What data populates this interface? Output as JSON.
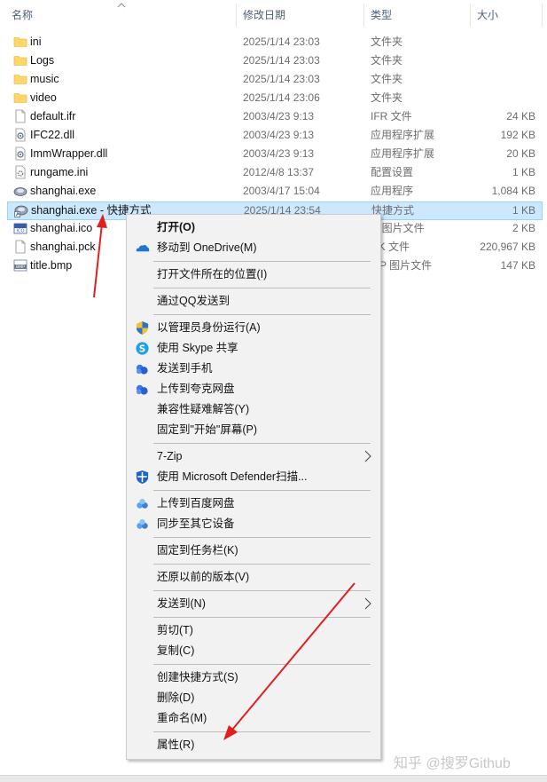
{
  "columns": {
    "name": "名称",
    "date": "修改日期",
    "type": "类型",
    "size": "大小"
  },
  "files": [
    {
      "name": "ini",
      "date": "2025/1/14 23:03",
      "type": "文件夹",
      "size": "",
      "icon": "folder-icon"
    },
    {
      "name": "Logs",
      "date": "2025/1/14 23:03",
      "type": "文件夹",
      "size": "",
      "icon": "folder-icon"
    },
    {
      "name": "music",
      "date": "2025/1/14 23:03",
      "type": "文件夹",
      "size": "",
      "icon": "folder-icon"
    },
    {
      "name": "video",
      "date": "2025/1/14 23:06",
      "type": "文件夹",
      "size": "",
      "icon": "folder-icon"
    },
    {
      "name": "default.ifr",
      "date": "2003/4/23 9:13",
      "type": "IFR 文件",
      "size": "24 KB",
      "icon": "file-icon"
    },
    {
      "name": "IFC22.dll",
      "date": "2003/4/23 9:13",
      "type": "应用程序扩展",
      "size": "192 KB",
      "icon": "dll-icon"
    },
    {
      "name": "ImmWrapper.dll",
      "date": "2003/4/23 9:13",
      "type": "应用程序扩展",
      "size": "20 KB",
      "icon": "dll-icon"
    },
    {
      "name": "rungame.ini",
      "date": "2012/4/8 13:37",
      "type": "配置设置",
      "size": "1 KB",
      "icon": "ini-icon"
    },
    {
      "name": "shanghai.exe",
      "date": "2003/4/17 15:04",
      "type": "应用程序",
      "size": "1,084 KB",
      "icon": "app-icon"
    },
    {
      "name": "shanghai.exe - 快捷方式",
      "date": "2025/1/14 23:54",
      "type": "快捷方式",
      "size": "1 KB",
      "icon": "shortcut-icon",
      "selected": true
    },
    {
      "name": "shanghai.ico",
      "date": "",
      "type": "O 图片文件",
      "size": "2 KB",
      "icon": "ico-icon"
    },
    {
      "name": "shanghai.pck",
      "date": "",
      "type": "CK 文件",
      "size": "220,967 KB",
      "icon": "file-icon"
    },
    {
      "name": "title.bmp",
      "date": "",
      "type": "MP 图片文件",
      "size": "147 KB",
      "icon": "bmp-icon"
    }
  ],
  "menu": [
    {
      "type": "item",
      "label": "打开(O)",
      "bold": true,
      "name": "menu-open"
    },
    {
      "type": "item",
      "label": "移动到 OneDrive(M)",
      "icon": "onedrive-icon",
      "name": "menu-move-onedrive"
    },
    {
      "type": "div"
    },
    {
      "type": "item",
      "label": "打开文件所在的位置(I)",
      "name": "menu-open-location"
    },
    {
      "type": "div"
    },
    {
      "type": "item",
      "label": "通过QQ发送到",
      "name": "menu-send-qq"
    },
    {
      "type": "div"
    },
    {
      "type": "item",
      "label": "以管理员身份运行(A)",
      "icon": "uac-shield-icon",
      "name": "menu-run-as-admin"
    },
    {
      "type": "item",
      "label": "使用 Skype 共享",
      "icon": "skype-icon",
      "name": "menu-share-skype"
    },
    {
      "type": "item",
      "label": "发送到手机",
      "icon": "cloud-icon",
      "name": "menu-send-phone"
    },
    {
      "type": "item",
      "label": "上传到夸克网盘",
      "icon": "cloud-icon",
      "name": "menu-upload-quark"
    },
    {
      "type": "item",
      "label": "兼容性疑难解答(Y)",
      "name": "menu-compat-troubleshoot"
    },
    {
      "type": "item",
      "label": "固定到\"开始\"屏幕(P)",
      "name": "menu-pin-start"
    },
    {
      "type": "div"
    },
    {
      "type": "item",
      "label": "7-Zip",
      "submenu": true,
      "name": "menu-7zip"
    },
    {
      "type": "item",
      "label": "使用 Microsoft Defender扫描...",
      "icon": "defender-icon",
      "name": "menu-defender-scan"
    },
    {
      "type": "div"
    },
    {
      "type": "item",
      "label": "上传到百度网盘",
      "icon": "baidu-icon",
      "name": "menu-upload-baidu"
    },
    {
      "type": "item",
      "label": "同步至其它设备",
      "icon": "baidu-icon",
      "name": "menu-sync-devices"
    },
    {
      "type": "div"
    },
    {
      "type": "item",
      "label": "固定到任务栏(K)",
      "name": "menu-pin-taskbar"
    },
    {
      "type": "div"
    },
    {
      "type": "item",
      "label": "还原以前的版本(V)",
      "name": "menu-restore-versions"
    },
    {
      "type": "div"
    },
    {
      "type": "item",
      "label": "发送到(N)",
      "submenu": true,
      "name": "menu-send-to"
    },
    {
      "type": "div"
    },
    {
      "type": "item",
      "label": "剪切(T)",
      "name": "menu-cut"
    },
    {
      "type": "item",
      "label": "复制(C)",
      "name": "menu-copy"
    },
    {
      "type": "div"
    },
    {
      "type": "item",
      "label": "创建快捷方式(S)",
      "name": "menu-create-shortcut"
    },
    {
      "type": "item",
      "label": "删除(D)",
      "name": "menu-delete"
    },
    {
      "type": "item",
      "label": "重命名(M)",
      "name": "menu-rename"
    },
    {
      "type": "div"
    },
    {
      "type": "item",
      "label": "属性(R)",
      "name": "menu-properties"
    }
  ],
  "watermark": "知乎 @搜罗Github",
  "colors": {
    "selection": "#cce8ff",
    "selection_border": "#99d1ff",
    "arrow": "#e02020",
    "menu_bg": "#f2f2f2"
  }
}
